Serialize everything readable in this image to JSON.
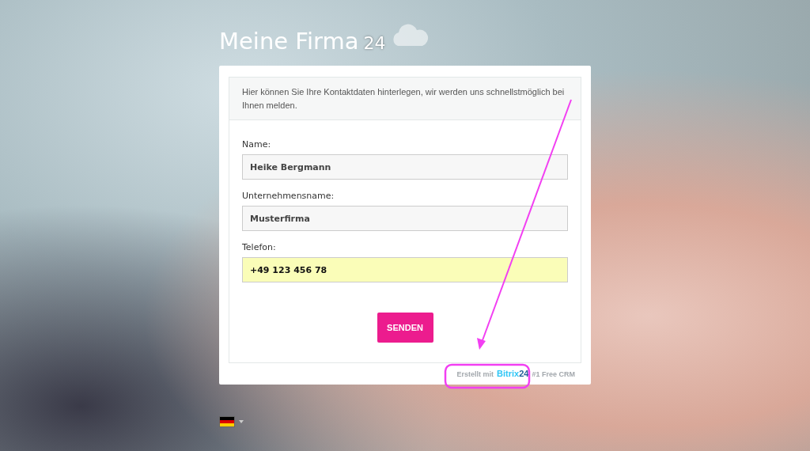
{
  "header": {
    "title": "Meine Firma",
    "logo_suffix": "24"
  },
  "form": {
    "intro": "Hier können Sie Ihre Kontaktdaten hinterlegen, wir werden uns schnellstmöglich bei Ihnen melden.",
    "fields": [
      {
        "label": "Name:",
        "value": "Heike Bergmann",
        "highlighted": false
      },
      {
        "label": "Unternehmensname:",
        "value": "Musterfirma",
        "highlighted": false
      },
      {
        "label": "Telefon:",
        "value": "+49 123 456 78",
        "highlighted": true
      }
    ],
    "submit": "SENDEN"
  },
  "footer": {
    "prefix": "Erstellt mit",
    "brand": "Bitrix",
    "brand_number": "24",
    "tagline": "#1 Free CRM"
  },
  "annotation": {
    "highlight_brand": true
  }
}
